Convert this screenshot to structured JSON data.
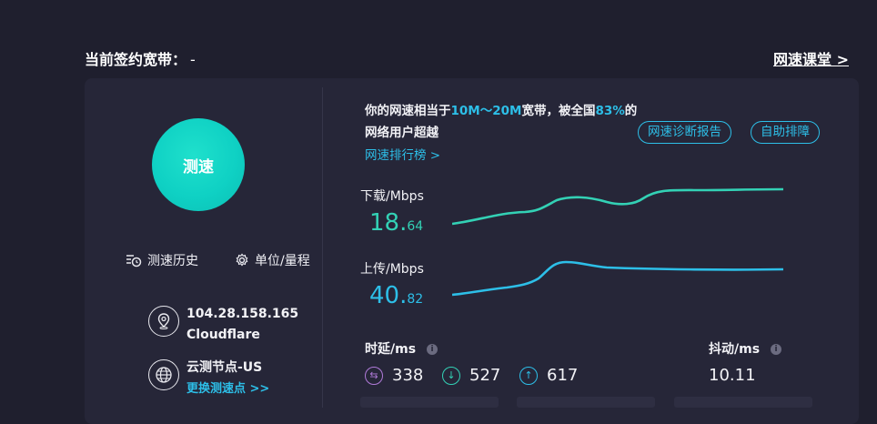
{
  "header": {
    "plan_label": "当前签约宽带：",
    "plan_value": "-",
    "class_link": "网速课堂 >"
  },
  "left": {
    "speed_button": "测速",
    "history": "测速历史",
    "units": "单位/量程",
    "server": {
      "ip": "104.28.158.165",
      "provider": "Cloudflare"
    },
    "node": {
      "name": "云测节点-US",
      "change": "更换测速点 >>"
    }
  },
  "summary": {
    "prefix": "你的网速相当于",
    "range": "10M～20M",
    "mid": "宽带，被全国",
    "percent": "83%",
    "suffix": "的",
    "line2": "网络用户超越",
    "rank_link": "网速排行榜 >",
    "diag_button": "网速诊断报告",
    "help_button": "自助排障"
  },
  "download": {
    "label": "下载/Mbps",
    "int": "18.",
    "dec": "64"
  },
  "upload": {
    "label": "上传/Mbps",
    "int": "40.",
    "dec": "82"
  },
  "latency": {
    "label": "时延/ms",
    "idle": "338",
    "down": "527",
    "up": "617"
  },
  "jitter": {
    "label": "抖动/ms",
    "value": "10.11"
  },
  "colors": {
    "accent": "#2dbfe8",
    "download": "#33d1b5",
    "background": "#1f1f2e",
    "card": "#262638"
  }
}
